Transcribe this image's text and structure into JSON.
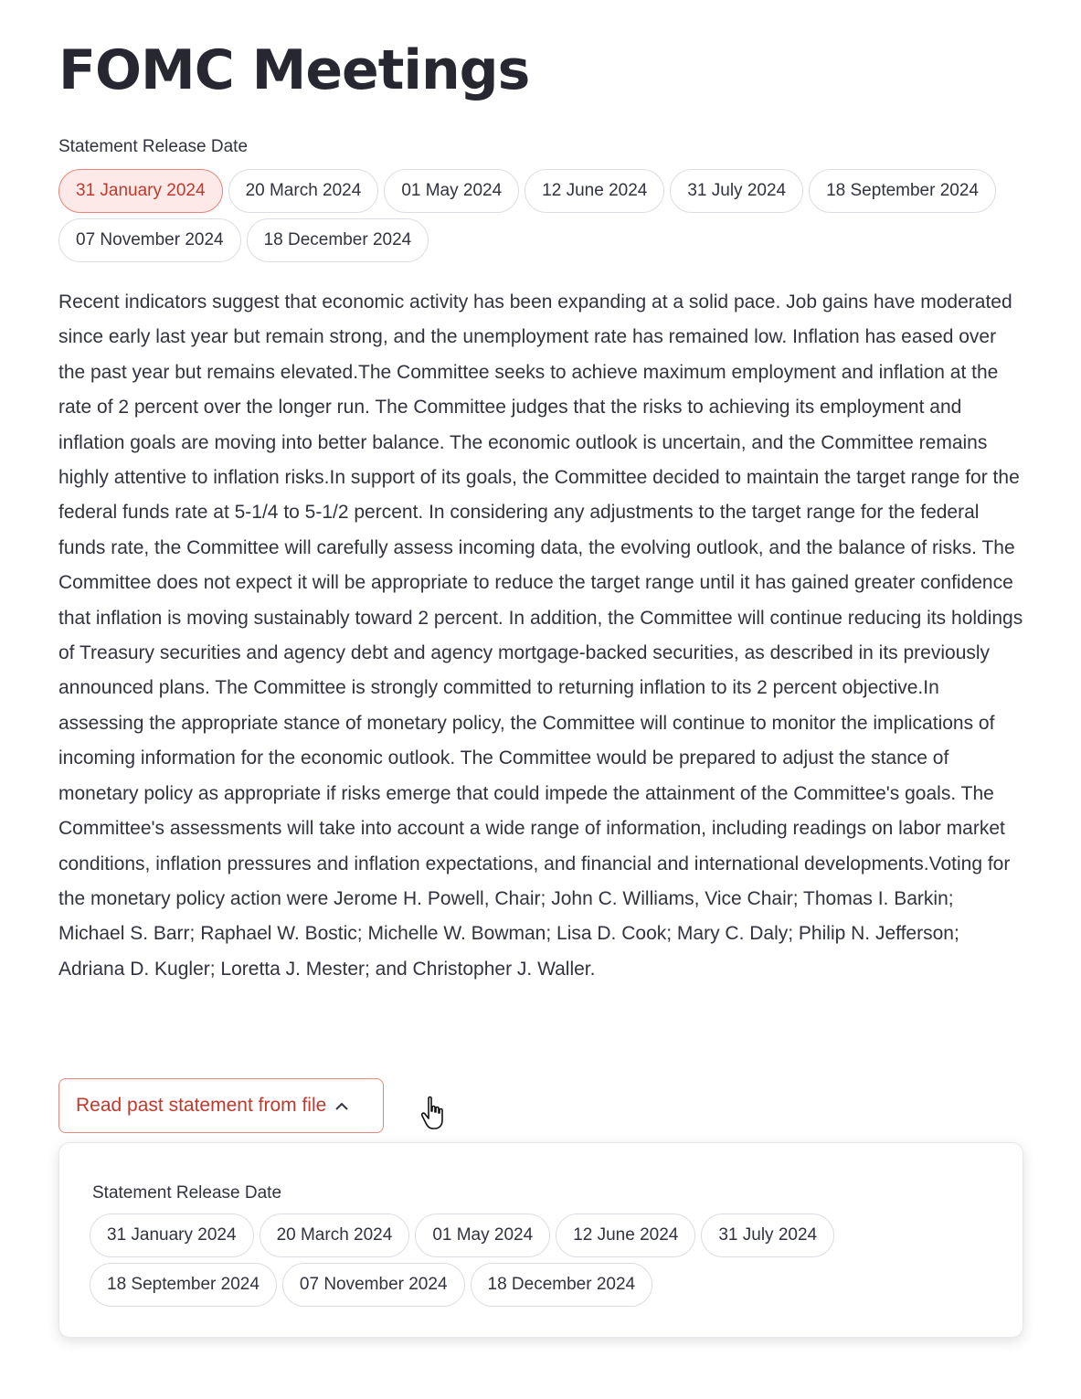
{
  "title": "FOMC Meetings",
  "selector": {
    "label": "Statement Release Date",
    "selected": "31 January 2024",
    "options": [
      "31 January 2024",
      "20 March 2024",
      "01 May 2024",
      "12 June 2024",
      "31 July 2024",
      "18 September 2024",
      "07 November 2024",
      "18 December 2024"
    ]
  },
  "statement": "Recent indicators suggest that economic activity has been expanding at a solid pace. Job gains have moderated since early last year but remain strong, and the unemployment rate has remained low. Inflation has eased over the past year but remains elevated.The Committee seeks to achieve maximum employment and inflation at the rate of 2 percent over the longer run. The Committee judges that the risks to achieving its employment and inflation goals are moving into better balance. The economic outlook is uncertain, and the Committee remains highly attentive to inflation risks.In support of its goals, the Committee decided to maintain the target range for the federal funds rate at 5-1/4 to 5-1/2 percent. In considering any adjustments to the target range for the federal funds rate, the Committee will carefully assess incoming data, the evolving outlook, and the balance of risks. The Committee does not expect it will be appropriate to reduce the target range until it has gained greater confidence that inflation is moving sustainably toward 2 percent. In addition, the Committee will continue reducing its holdings of Treasury securities and agency debt and agency mortgage-backed securities, as described in its previously announced plans. The Committee is strongly committed to returning inflation to its 2 percent objective.In assessing the appropriate stance of monetary policy, the Committee will continue to monitor the implications of incoming information for the economic outlook. The Committee would be prepared to adjust the stance of monetary policy as appropriate if risks emerge that could impede the attainment of the Committee's goals. The Committee's assessments will take into account a wide range of information, including readings on labor market conditions, inflation pressures and inflation expectations, and financial and international developments.Voting for the monetary policy action were Jerome H. Powell, Chair; John C. Williams, Vice Chair; Thomas I. Barkin; Michael S. Barr; Raphael W. Bostic; Michelle W. Bowman; Lisa D. Cook; Mary C. Daly; Philip N. Jefferson; Adriana D. Kugler; Loretta J. Mester; and Christopher J. Waller.",
  "expander": {
    "label": "Read past statement from file",
    "icon": "chevron-up-icon",
    "panel": {
      "label": "Statement Release Date",
      "options": [
        "31 January 2024",
        "20 March 2024",
        "01 May 2024",
        "12 June 2024",
        "31 July 2024",
        "18 September 2024",
        "07 November 2024",
        "18 December 2024"
      ]
    }
  },
  "colors": {
    "accent": "#c0392b",
    "accent_border": "#e8857a",
    "selected_bg": "#fde9e8",
    "text": "#31333f"
  }
}
